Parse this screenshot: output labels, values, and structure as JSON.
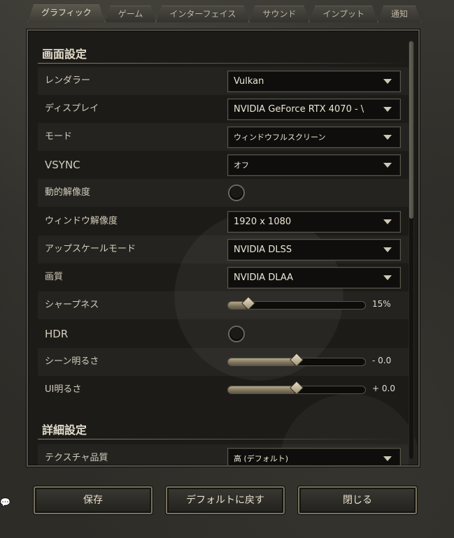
{
  "tabs": [
    {
      "label": "グラフィック",
      "active": true
    },
    {
      "label": "ゲーム",
      "active": false
    },
    {
      "label": "インターフェイス",
      "active": false
    },
    {
      "label": "サウンド",
      "active": false
    },
    {
      "label": "インプット",
      "active": false
    },
    {
      "label": "通知",
      "active": false
    }
  ],
  "sections": {
    "display_title": "画面設定",
    "advanced_title": "詳細設定"
  },
  "settings": {
    "renderer": {
      "label": "レンダラー",
      "value": "Vulkan"
    },
    "display": {
      "label": "ディスプレイ",
      "value": "NVIDIA GeForce RTX 4070 - \\"
    },
    "mode": {
      "label": "モード",
      "value": "ウィンドウフルスクリーン"
    },
    "vsync": {
      "label": "VSYNC",
      "value": "オフ"
    },
    "dynamic_resolution": {
      "label": "動的解像度",
      "enabled": false
    },
    "window_resolution": {
      "label": "ウィンドウ解像度",
      "value": "1920 x 1080"
    },
    "upscale_mode": {
      "label": "アップスケールモード",
      "value": "NVIDIA DLSS"
    },
    "quality": {
      "label": "画質",
      "value": "NVIDIA DLAA"
    },
    "sharpness": {
      "label": "シャープネス",
      "value_text": "15%",
      "fraction": 0.15
    },
    "hdr": {
      "label": "HDR",
      "enabled": false
    },
    "scene_brightness": {
      "label": "シーン明るさ",
      "value_text": "- 0.0",
      "fraction": 0.5
    },
    "ui_brightness": {
      "label": "UI明るさ",
      "value_text": "+ 0.0",
      "fraction": 0.5
    },
    "texture_quality": {
      "label": "テクスチャ品質",
      "value": "高 (デフォルト)"
    }
  },
  "buttons": {
    "save": "保存",
    "reset": "デフォルトに戻す",
    "close": "閉じる"
  },
  "scrollbar": {
    "position": 0.0
  },
  "icons": {
    "dropdown": "chevron-down-icon",
    "chat": "chat-bubble-icon"
  },
  "colors": {
    "panel_bg": "#1c1b18",
    "accent": "#b4a98a",
    "text": "#d8d2c2"
  }
}
